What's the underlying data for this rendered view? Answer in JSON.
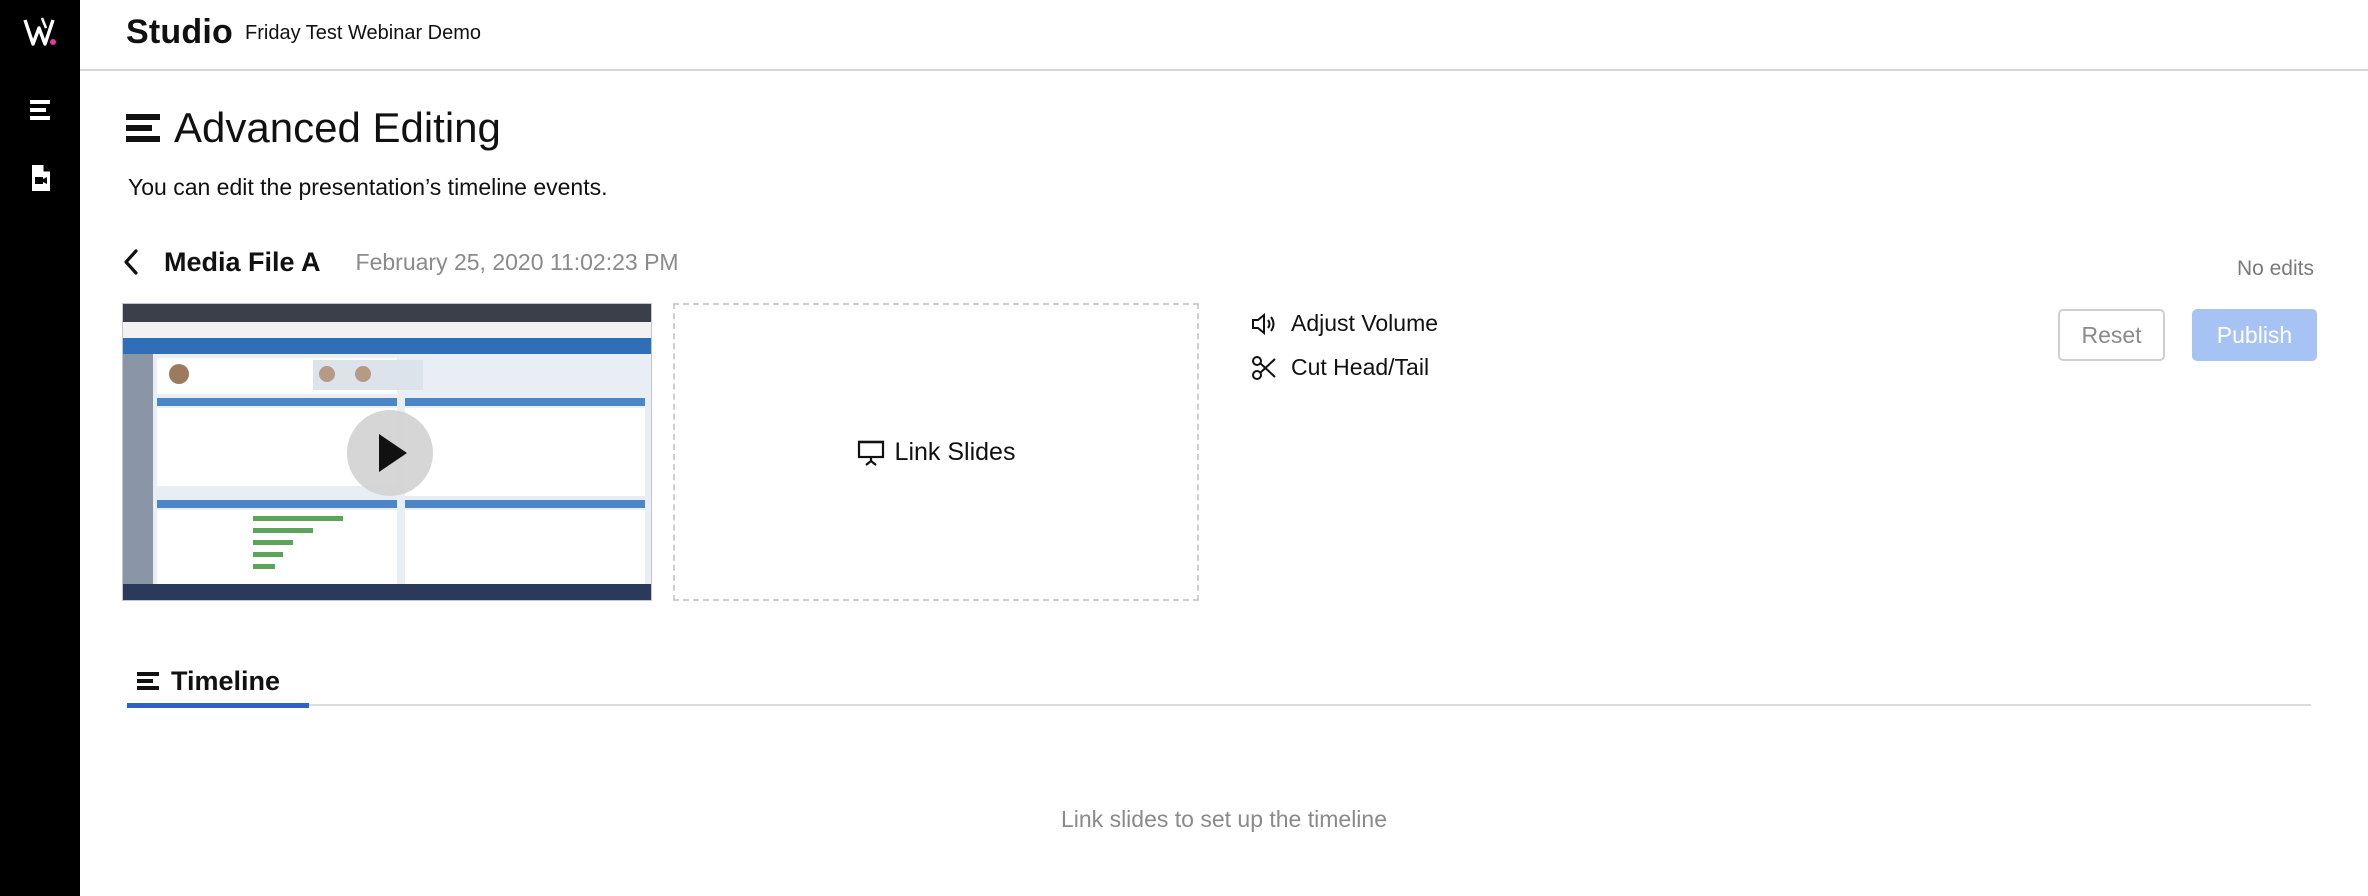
{
  "app": {
    "name": "Studio",
    "event_name": "Friday Test Webinar Demo"
  },
  "sidebar": {
    "items": [
      {
        "icon": "list-icon",
        "label": "Advanced Editing"
      },
      {
        "icon": "media-file-icon",
        "label": "Media"
      }
    ]
  },
  "page": {
    "title": "Advanced Editing",
    "subtitle": "You can edit the presentation’s timeline events."
  },
  "media": {
    "name": "Media File A",
    "date": "February 25, 2020 11:02:23 PM",
    "status": "No edits"
  },
  "link_slides": {
    "label": "Link Slides"
  },
  "tools": [
    {
      "icon": "volume-icon",
      "label": "Adjust Volume"
    },
    {
      "icon": "scissors-icon",
      "label": "Cut Head/Tail"
    }
  ],
  "actions": {
    "reset_label": "Reset",
    "publish_label": "Publish"
  },
  "timeline": {
    "tab_label": "Timeline",
    "empty_message": "Link slides to set up the timeline"
  },
  "colors": {
    "accent": "#2d62c6",
    "publish_disabled": "#a7c3f3",
    "sidebar": "#000000"
  }
}
